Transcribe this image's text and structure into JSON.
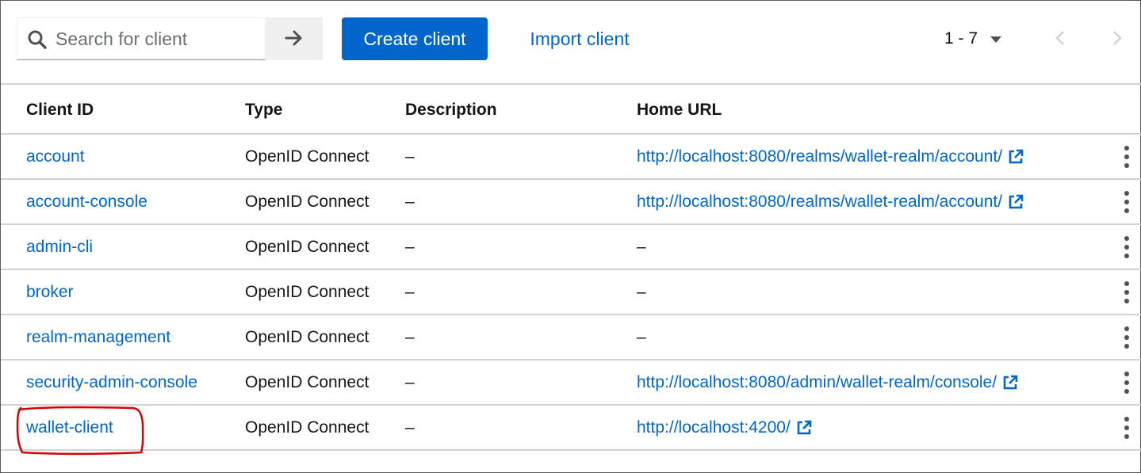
{
  "toolbar": {
    "search_placeholder": "Search for client",
    "search_value": "",
    "create_label": "Create client",
    "import_label": "Import client",
    "pagination_range": "1 - 7"
  },
  "table": {
    "headers": {
      "client_id": "Client ID",
      "type": "Type",
      "description": "Description",
      "home_url": "Home URL"
    },
    "rows": [
      {
        "client_id": "account",
        "type": "OpenID Connect",
        "description": "–",
        "home_url": "http://localhost:8080/realms/wallet-realm/account/",
        "url_is_link": true
      },
      {
        "client_id": "account-console",
        "type": "OpenID Connect",
        "description": "–",
        "home_url": "http://localhost:8080/realms/wallet-realm/account/",
        "url_is_link": true
      },
      {
        "client_id": "admin-cli",
        "type": "OpenID Connect",
        "description": "–",
        "home_url": "–",
        "url_is_link": false
      },
      {
        "client_id": "broker",
        "type": "OpenID Connect",
        "description": "–",
        "home_url": "–",
        "url_is_link": false
      },
      {
        "client_id": "realm-management",
        "type": "OpenID Connect",
        "description": "–",
        "home_url": "–",
        "url_is_link": false
      },
      {
        "client_id": "security-admin-console",
        "type": "OpenID Connect",
        "description": "–",
        "home_url": "http://localhost:8080/admin/wallet-realm/console/",
        "url_is_link": true
      },
      {
        "client_id": "wallet-client",
        "type": "OpenID Connect",
        "description": "–",
        "home_url": "http://localhost:4200/",
        "url_is_link": true
      }
    ]
  },
  "icons": {
    "search": "search-icon",
    "go": "arrow-right-icon",
    "pagination_toggle": "caret-down-icon",
    "prev": "chevron-left-icon",
    "next": "chevron-right-icon",
    "external_link": "external-link-icon",
    "row_actions": "kebab-icon"
  },
  "colors": {
    "primary": "#0066cc",
    "link": "#0066cc",
    "annotation": "#d90000",
    "border": "#d2d2d2"
  }
}
